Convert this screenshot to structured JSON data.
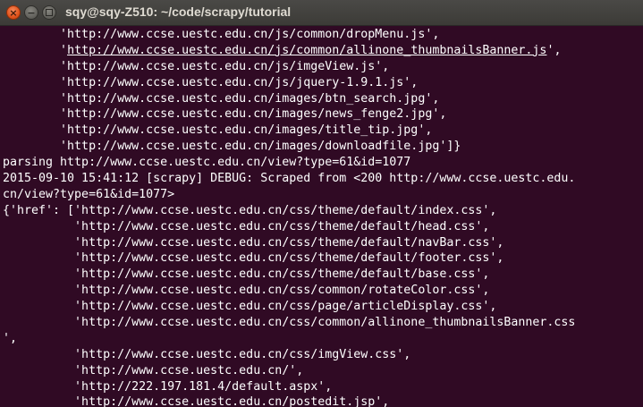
{
  "window": {
    "title": "sqy@sqy-Z510: ~/code/scrapy/tutorial",
    "close_icon": "×",
    "minimize_icon": "−"
  },
  "terminal": {
    "lines": [
      "        'http://www.ccse.uestc.edu.cn/js/common/dropMenu.js',",
      "        'http://www.ccse.uestc.edu.cn/js/common/allinone_thumbnailsBanner.js',",
      "        'http://www.ccse.uestc.edu.cn/js/imgeView.js',",
      "        'http://www.ccse.uestc.edu.cn/js/jquery-1.9.1.js',",
      "        'http://www.ccse.uestc.edu.cn/images/btn_search.jpg',",
      "        'http://www.ccse.uestc.edu.cn/images/news_fenge2.jpg',",
      "        'http://www.ccse.uestc.edu.cn/images/title_tip.jpg',",
      "        'http://www.ccse.uestc.edu.cn/images/downloadfile.jpg']}",
      "parsing http://www.ccse.uestc.edu.cn/view?type=61&id=1077",
      "2015-09-10 15:41:12 [scrapy] DEBUG: Scraped from <200 http://www.ccse.uestc.edu.",
      "cn/view?type=61&id=1077>",
      "{'href': ['http://www.ccse.uestc.edu.cn/css/theme/default/index.css',",
      "          'http://www.ccse.uestc.edu.cn/css/theme/default/head.css',",
      "          'http://www.ccse.uestc.edu.cn/css/theme/default/navBar.css',",
      "          'http://www.ccse.uestc.edu.cn/css/theme/default/footer.css',",
      "          'http://www.ccse.uestc.edu.cn/css/theme/default/base.css',",
      "          'http://www.ccse.uestc.edu.cn/css/common/rotateColor.css',",
      "          'http://www.ccse.uestc.edu.cn/css/page/articleDisplay.css',",
      "          'http://www.ccse.uestc.edu.cn/css/common/allinone_thumbnailsBanner.css",
      "',",
      "          'http://www.ccse.uestc.edu.cn/css/imgView.css',",
      "          'http://www.ccse.uestc.edu.cn/',",
      "          'http://222.197.181.4/default.aspx',",
      "          'http://www.ccse.uestc.edu.cn/postedit.jsp',"
    ]
  },
  "colors": {
    "terminal_bg": "#300a24",
    "terminal_fg": "#ffffff",
    "titlebar": "#3c3b37",
    "close_button": "#e0531c"
  }
}
